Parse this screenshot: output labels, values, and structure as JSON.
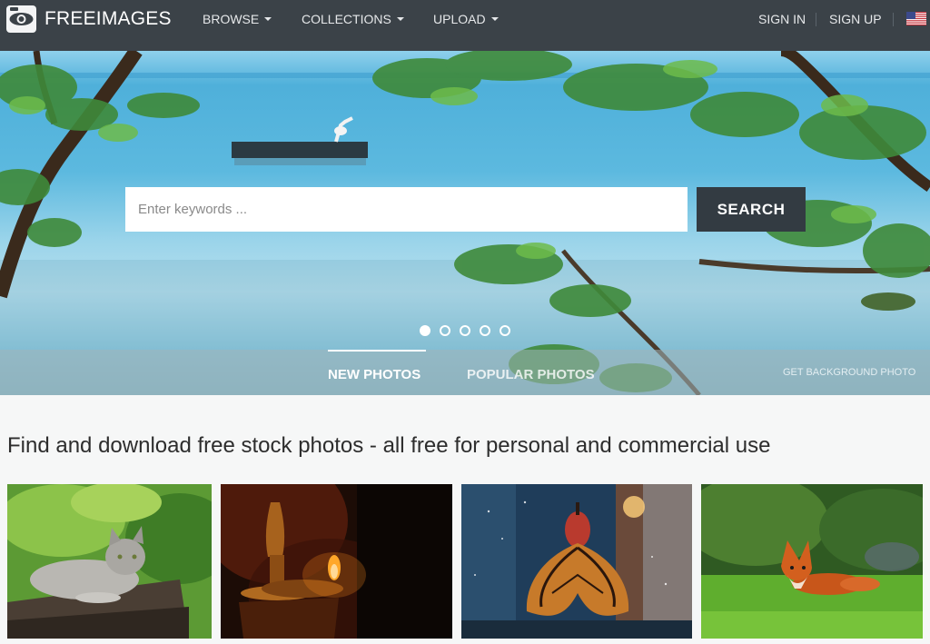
{
  "brand": {
    "name": "FREEIMAGES"
  },
  "nav": {
    "browse": "BROWSE",
    "collections": "COLLECTIONS",
    "upload": "UPLOAD",
    "sign_in": "SIGN IN",
    "sign_up": "SIGN UP"
  },
  "search": {
    "placeholder": "Enter keywords ...",
    "button": "SEARCH"
  },
  "hero": {
    "tabs": [
      "NEW PHOTOS",
      "POPULAR PHOTOS"
    ],
    "background_link": "GET BACKGROUND PHOTO",
    "slide_count": 5,
    "active_slide": 1
  },
  "headline": "Find and download free stock photos - all free for personal and commercial use",
  "photos": [
    {
      "subject": "cat"
    },
    {
      "subject": "oil lamp"
    },
    {
      "subject": "butterfly dress"
    },
    {
      "subject": "fox"
    }
  ],
  "colors": {
    "navbar": "#3b4248",
    "search_button": "#333b42",
    "page_bg": "#f6f7f7"
  }
}
